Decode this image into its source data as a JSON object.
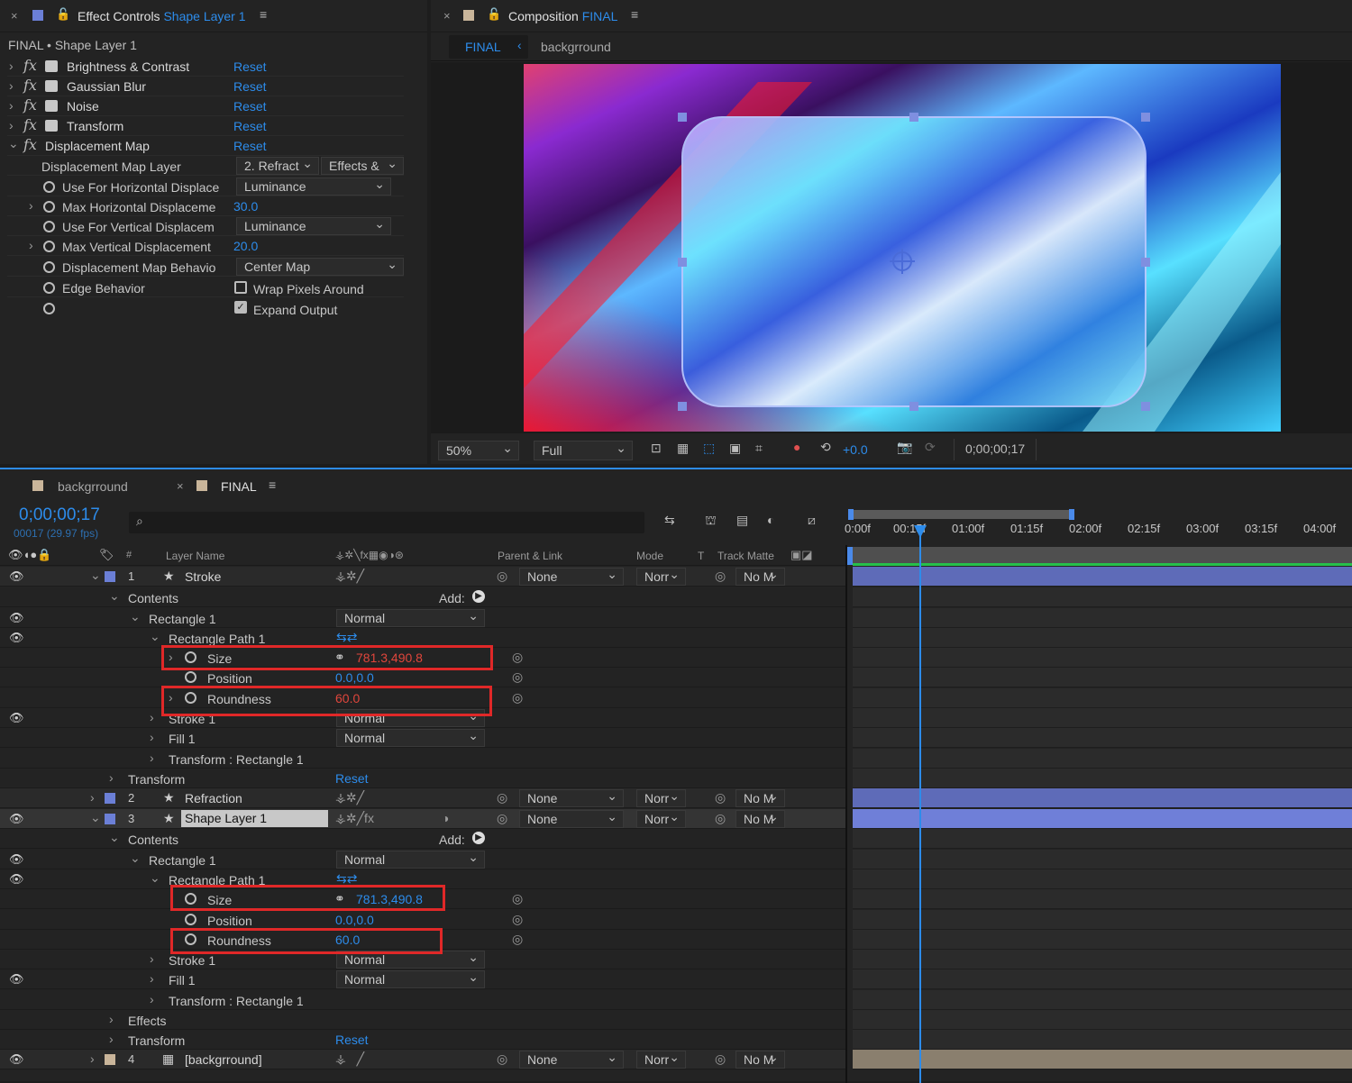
{
  "effect_controls": {
    "tab_title": "Effect Controls",
    "layer_name": "Shape Layer 1",
    "breadcrumb": "FINAL • Shape Layer 1",
    "effects": [
      {
        "name": "Brightness & Contrast",
        "reset": "Reset"
      },
      {
        "name": "Gaussian Blur",
        "reset": "Reset"
      },
      {
        "name": "Noise",
        "reset": "Reset"
      },
      {
        "name": "Transform",
        "reset": "Reset"
      },
      {
        "name": "Displacement Map",
        "reset": "Reset"
      }
    ],
    "props": {
      "map_layer_label": "Displacement Map Layer",
      "map_layer_value": "2. Refract",
      "map_layer_source": "Effects &",
      "h_use_label": "Use For Horizontal Displace",
      "h_use_value": "Luminance",
      "h_max_label": "Max Horizontal Displaceme",
      "h_max_value": "30.0",
      "v_use_label": "Use For Vertical Displacem",
      "v_use_value": "Luminance",
      "v_max_label": "Max Vertical Displacement",
      "v_max_value": "20.0",
      "behavior_label": "Displacement Map Behavio",
      "behavior_value": "Center Map",
      "edge_label": "Edge Behavior",
      "wrap_label": "Wrap Pixels Around",
      "expand_label": "Expand Output"
    }
  },
  "composition": {
    "tab_title": "Composition",
    "comp_name": "FINAL",
    "breadcrumb_active": "FINAL",
    "breadcrumb_next": "backgrround",
    "zoom": "50%",
    "resolution": "Full",
    "exposure": "+0.0",
    "timecode": "0;00;00;17"
  },
  "timeline": {
    "tabs": [
      {
        "label": "backgrround"
      },
      {
        "label": "FINAL"
      }
    ],
    "timecode": "0;00;00;17",
    "frame_info": "00017 (29.97 fps)",
    "columns": {
      "layer_name": "Layer Name",
      "parent": "Parent & Link",
      "mode": "Mode",
      "t": "T",
      "track_matte": "Track Matte"
    },
    "ruler": [
      "0:00f",
      "00:15f",
      "01:00f",
      "01:15f",
      "02:00f",
      "02:15f",
      "03:00f",
      "03:15f",
      "04:00f"
    ],
    "labels": {
      "contents": "Contents",
      "add": "Add:",
      "rectangle1": "Rectangle 1",
      "rect_path1": "Rectangle Path 1",
      "size": "Size",
      "position": "Position",
      "roundness": "Roundness",
      "stroke1": "Stroke 1",
      "fill1": "Fill 1",
      "transform_rect": "Transform : Rectangle 1",
      "transform": "Transform",
      "effects": "Effects",
      "reset": "Reset",
      "normal": "Normal",
      "none": "None",
      "norr": "Norr",
      "nom": "No M"
    },
    "layers": [
      {
        "num": "1",
        "name": "Stroke"
      },
      {
        "num": "2",
        "name": "Refraction"
      },
      {
        "num": "3",
        "name": "Shape Layer 1"
      },
      {
        "num": "4",
        "name": "[backgrround]"
      }
    ],
    "values": {
      "size": "781.3,490.8",
      "position": "0.0,0.0",
      "roundness": "60.0"
    }
  },
  "colors": {
    "accent": "#2d8ceb",
    "highlight_box": "#e02828",
    "layer_label": "#6b7fd6",
    "bg_label": "#c9b59a"
  }
}
